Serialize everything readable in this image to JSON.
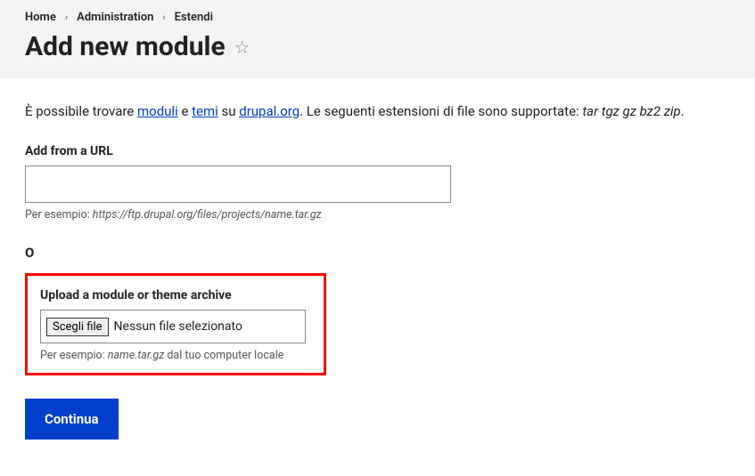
{
  "breadcrumb": {
    "home": "Home",
    "admin": "Administration",
    "extend": "Estendi"
  },
  "page_title": "Add new module",
  "intro": {
    "prefix": "È possibile trovare ",
    "link_modules": "moduli",
    "mid1": " e ",
    "link_themes": "temi",
    "mid2": " su ",
    "link_drupal": "drupal.org",
    "suffix": ". Le seguenti estensioni di file sono supportate: ",
    "exts": "tar tgz gz bz2 zip",
    "period": "."
  },
  "url_field": {
    "label": "Add from a URL",
    "value": "",
    "help_prefix": "Per esempio: ",
    "help_example": "https://ftp.drupal.org/files/projects/name.tar.gz"
  },
  "or_label": "O",
  "upload_field": {
    "label": "Upload a module or theme archive",
    "choose_btn": "Scegli file",
    "no_file": "Nessun file selezionato",
    "help_prefix": "Per esempio: ",
    "help_example": "name.tar.gz",
    "help_suffix": " dal tuo computer locale"
  },
  "submit_label": "Continua"
}
